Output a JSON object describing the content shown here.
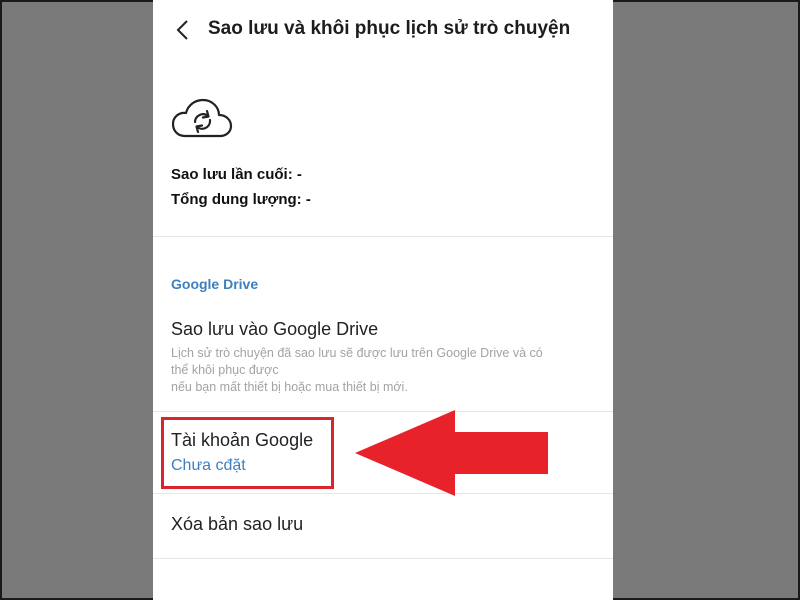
{
  "header": {
    "title": "Sao lưu và khôi phục lịch sử trò chuyện"
  },
  "backup_info": {
    "last_backup": "Sao lưu lần cuối: -",
    "total_size": "Tổng dung lượng: -"
  },
  "google_drive_section": {
    "header": "Google Drive",
    "backup_to_drive": {
      "title": "Sao lưu vào Google Drive",
      "description_lines": [
        "Lịch sử trò chuyện đã sao lưu sẽ được lưu trên Google Drive và có",
        "thể khôi phục được",
        "nếu bạn mất thiết bị hoặc mua thiết bị mới."
      ]
    },
    "google_account": {
      "title": "Tài khoản Google",
      "value": "Chưa cđặt"
    },
    "delete_backup": {
      "title": "Xóa bản sao lưu"
    }
  },
  "colors": {
    "accent": "#3f7fbf",
    "annotation_red": "#e8222b",
    "background_gray": "#7a7a7a"
  },
  "icons": [
    "back-chevron-icon",
    "cloud-sync-icon",
    "red-arrow-annotation"
  ]
}
